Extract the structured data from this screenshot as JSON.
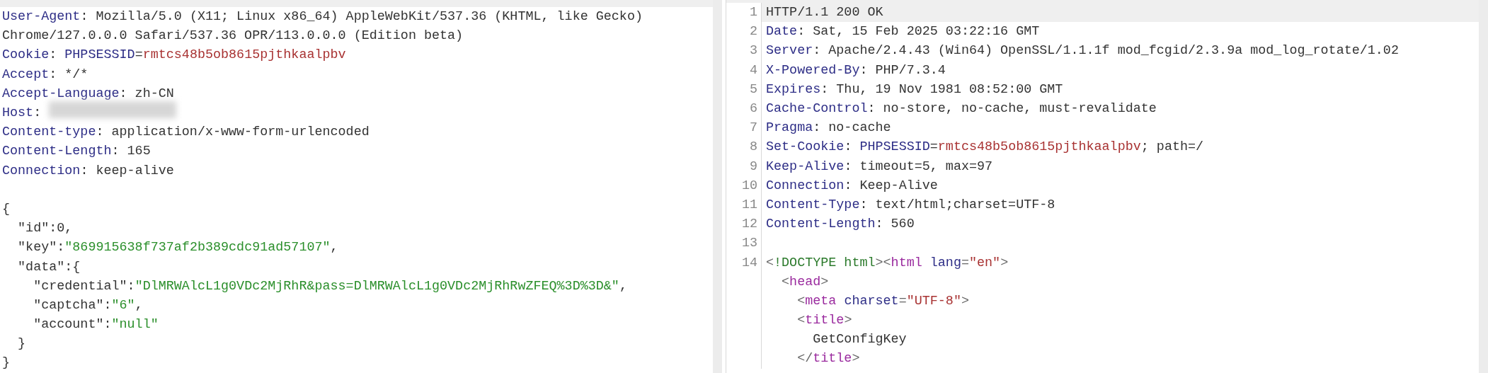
{
  "request": {
    "lines": [
      {
        "segments": [
          {
            "text": "User-Agent",
            "kind": "name"
          },
          {
            "text": ": Mozilla/5.0 (X11; Linux x86_64) AppleWebKit/537.36 (KHTML, like Gecko)",
            "kind": "text"
          }
        ]
      },
      {
        "segments": [
          {
            "text": "Chrome/127.0.0.0 Safari/537.36 OPR/113.0.0.0 (Edition beta)",
            "kind": "text"
          }
        ]
      },
      {
        "segments": [
          {
            "text": "Cookie",
            "kind": "name"
          },
          {
            "text": ": ",
            "kind": "text"
          },
          {
            "text": "PHPSESSID",
            "kind": "name"
          },
          {
            "text": "=",
            "kind": "text"
          },
          {
            "text": "rmtcs48b5ob8615pjthkaalpbv",
            "kind": "sessid"
          }
        ]
      },
      {
        "segments": [
          {
            "text": "Accept",
            "kind": "name"
          },
          {
            "text": ": */*",
            "kind": "text"
          }
        ]
      },
      {
        "segments": [
          {
            "text": "Accept-Language",
            "kind": "name"
          },
          {
            "text": ": zh-CN",
            "kind": "text"
          }
        ]
      },
      {
        "segments": [
          {
            "text": "Host",
            "kind": "name"
          },
          {
            "text": ": ",
            "kind": "text"
          }
        ],
        "redacted": true
      },
      {
        "segments": [
          {
            "text": "Content-type",
            "kind": "name"
          },
          {
            "text": ": application/x-www-form-urlencoded",
            "kind": "text"
          }
        ]
      },
      {
        "segments": [
          {
            "text": "Content-Length",
            "kind": "name"
          },
          {
            "text": ": 165",
            "kind": "text"
          }
        ]
      },
      {
        "segments": [
          {
            "text": "Connection",
            "kind": "name"
          },
          {
            "text": ": keep-alive",
            "kind": "text"
          }
        ]
      }
    ],
    "body": [
      {
        "segments": [
          {
            "text": "{",
            "kind": "key"
          }
        ]
      },
      {
        "segments": [
          {
            "text": "  \"id\":0,",
            "kind": "key"
          }
        ]
      },
      {
        "segments": [
          {
            "text": "  \"key\":",
            "kind": "key"
          },
          {
            "text": "\"869915638f737af2b389cdc91ad57107\"",
            "kind": "string"
          },
          {
            "text": ",",
            "kind": "key"
          }
        ]
      },
      {
        "segments": [
          {
            "text": "  \"data\":{",
            "kind": "key"
          }
        ]
      },
      {
        "segments": [
          {
            "text": "    \"credential\":",
            "kind": "key"
          },
          {
            "text": "\"DlMRWAlcL1g0VDc2MjRhR&pass=DlMRWAlcL1g0VDc2MjRhRwZFEQ%3D%3D&\"",
            "kind": "string"
          },
          {
            "text": ",",
            "kind": "key"
          }
        ]
      },
      {
        "segments": [
          {
            "text": "    \"captcha\":",
            "kind": "key"
          },
          {
            "text": "\"6\"",
            "kind": "string"
          },
          {
            "text": ",",
            "kind": "key"
          }
        ]
      },
      {
        "segments": [
          {
            "text": "    \"account\":",
            "kind": "key"
          },
          {
            "text": "\"null\"",
            "kind": "string"
          }
        ]
      },
      {
        "segments": [
          {
            "text": "  }",
            "kind": "key"
          }
        ]
      },
      {
        "segments": [
          {
            "text": "}",
            "kind": "key"
          }
        ]
      }
    ]
  },
  "response": {
    "lines": [
      {
        "number": "1",
        "highlighted": true,
        "segments": [
          {
            "text": "HTTP/1.1 200 OK",
            "kind": "text"
          }
        ]
      },
      {
        "number": "2",
        "highlighted": false,
        "segments": [
          {
            "text": "Date",
            "kind": "name"
          },
          {
            "text": ": Sat, 15 Feb 2025 03:22:16 GMT",
            "kind": "text"
          }
        ]
      },
      {
        "number": "3",
        "highlighted": false,
        "segments": [
          {
            "text": "Server",
            "kind": "name"
          },
          {
            "text": ": Apache/2.4.43 (Win64) OpenSSL/1.1.1f mod_fcgid/2.3.9a mod_log_rotate/1.02",
            "kind": "text"
          }
        ]
      },
      {
        "number": "4",
        "highlighted": false,
        "segments": [
          {
            "text": "X-Powered-By",
            "kind": "name"
          },
          {
            "text": ": PHP/7.3.4",
            "kind": "text"
          }
        ]
      },
      {
        "number": "5",
        "highlighted": false,
        "segments": [
          {
            "text": "Expires",
            "kind": "name"
          },
          {
            "text": ": Thu, 19 Nov 1981 08:52:00 GMT",
            "kind": "text"
          }
        ]
      },
      {
        "number": "6",
        "highlighted": false,
        "segments": [
          {
            "text": "Cache-Control",
            "kind": "name"
          },
          {
            "text": ": no-store, no-cache, must-revalidate",
            "kind": "text"
          }
        ]
      },
      {
        "number": "7",
        "highlighted": false,
        "segments": [
          {
            "text": "Pragma",
            "kind": "name"
          },
          {
            "text": ": no-cache",
            "kind": "text"
          }
        ]
      },
      {
        "number": "8",
        "highlighted": false,
        "segments": [
          {
            "text": "Set-Cookie",
            "kind": "name"
          },
          {
            "text": ": ",
            "kind": "text"
          },
          {
            "text": "PHPSESSID",
            "kind": "name"
          },
          {
            "text": "=",
            "kind": "text"
          },
          {
            "text": "rmtcs48b5ob8615pjthkaalpbv",
            "kind": "sessid"
          },
          {
            "text": "; path=/",
            "kind": "text"
          }
        ]
      },
      {
        "number": "9",
        "highlighted": false,
        "segments": [
          {
            "text": "Keep-Alive",
            "kind": "name"
          },
          {
            "text": ": timeout=5, max=97",
            "kind": "text"
          }
        ]
      },
      {
        "number": "10",
        "highlighted": false,
        "segments": [
          {
            "text": "Connection",
            "kind": "name"
          },
          {
            "text": ": Keep-Alive",
            "kind": "text"
          }
        ]
      },
      {
        "number": "11",
        "highlighted": false,
        "segments": [
          {
            "text": "Content-Type",
            "kind": "name"
          },
          {
            "text": ": text/html;charset=UTF-8",
            "kind": "text"
          }
        ]
      },
      {
        "number": "12",
        "highlighted": false,
        "segments": [
          {
            "text": "Content-Length",
            "kind": "name"
          },
          {
            "text": ": 560",
            "kind": "text"
          }
        ]
      },
      {
        "number": "13",
        "highlighted": false
      },
      {
        "number": "14",
        "highlighted": false,
        "segments": [
          {
            "text": "<",
            "kind": "punct"
          },
          {
            "text": "!DOCTYPE html",
            "kind": "doctype"
          },
          {
            "text": "><",
            "kind": "punct"
          },
          {
            "text": "html",
            "kind": "tag"
          },
          {
            "text": " lang",
            "kind": "attr"
          },
          {
            "text": "=",
            "kind": "punct"
          },
          {
            "text": "\"en\"",
            "kind": "attrval"
          },
          {
            "text": ">",
            "kind": "punct"
          }
        ]
      },
      {
        "highlighted": false,
        "segments": [
          {
            "text": "  <",
            "kind": "punct"
          },
          {
            "text": "head",
            "kind": "tag"
          },
          {
            "text": ">",
            "kind": "punct"
          }
        ]
      },
      {
        "highlighted": false,
        "segments": [
          {
            "text": "    <",
            "kind": "punct"
          },
          {
            "text": "meta",
            "kind": "tag"
          },
          {
            "text": " charset",
            "kind": "attr"
          },
          {
            "text": "=",
            "kind": "punct"
          },
          {
            "text": "\"UTF-8\"",
            "kind": "attrval"
          },
          {
            "text": ">",
            "kind": "punct"
          }
        ]
      },
      {
        "highlighted": false,
        "segments": [
          {
            "text": "    <",
            "kind": "punct"
          },
          {
            "text": "title",
            "kind": "tag"
          },
          {
            "text": ">",
            "kind": "punct"
          }
        ]
      },
      {
        "highlighted": false,
        "segments": [
          {
            "text": "      GetConfigKey",
            "kind": "text"
          }
        ]
      },
      {
        "highlighted": false,
        "segments": [
          {
            "text": "    </",
            "kind": "punct"
          },
          {
            "text": "title",
            "kind": "tag"
          },
          {
            "text": ">",
            "kind": "punct"
          }
        ]
      }
    ]
  }
}
